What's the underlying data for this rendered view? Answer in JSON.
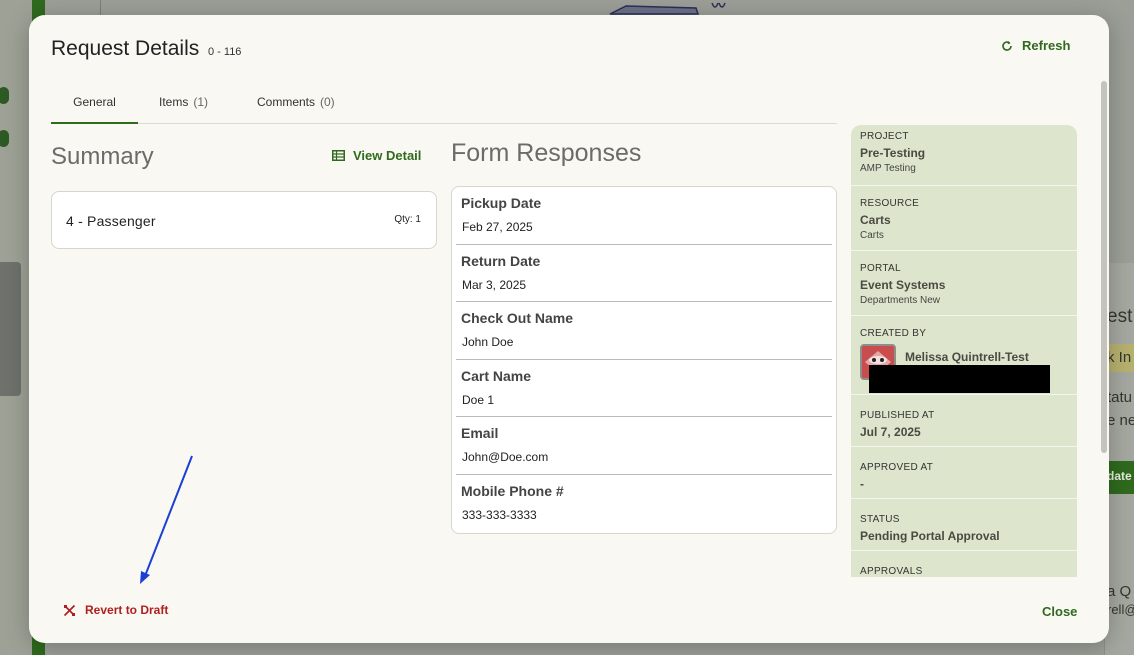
{
  "modal": {
    "title": "Request Details",
    "request_id": "0 - 116",
    "refresh_label": "Refresh",
    "revert_label": "Revert to Draft",
    "close_label": "Close"
  },
  "tabs": [
    {
      "label": "General",
      "count": ""
    },
    {
      "label": "Items",
      "count": "(1)"
    },
    {
      "label": "Comments",
      "count": "(0)"
    }
  ],
  "summary": {
    "title": "Summary",
    "view_detail_label": "View Detail",
    "items": [
      {
        "name": "4 - Passenger",
        "qty": "Qty: 1"
      }
    ]
  },
  "form_responses": {
    "title": "Form Responses",
    "fields": [
      {
        "label": "Pickup Date",
        "value": "Feb 27, 2025"
      },
      {
        "label": "Return Date",
        "value": "Mar 3, 2025"
      },
      {
        "label": "Check Out Name",
        "value": "John Doe"
      },
      {
        "label": "Cart Name",
        "value": "Doe 1"
      },
      {
        "label": "Email",
        "value": "John@Doe.com"
      },
      {
        "label": "Mobile Phone #",
        "value": "333-333-3333"
      }
    ]
  },
  "side_panel": {
    "project": {
      "label": "PROJECT",
      "value": "Pre-Testing",
      "sub": "AMP Testing"
    },
    "resource": {
      "label": "RESOURCE",
      "value": "Carts",
      "sub": "Carts"
    },
    "portal": {
      "label": "PORTAL",
      "value": "Event Systems",
      "sub": "Departments New"
    },
    "created_by": {
      "label": "CREATED BY",
      "value": "Melissa Quintrell-Test"
    },
    "published_at": {
      "label": "PUBLISHED AT",
      "value": "Jul 7, 2025"
    },
    "approved_at": {
      "label": "APPROVED AT",
      "value": "-"
    },
    "status": {
      "label": "STATUS",
      "value": "Pending Portal Approval"
    },
    "approvals": {
      "label": "APPROVALS"
    }
  },
  "background": {
    "right_texts": [
      "est",
      "k In",
      "tatu",
      "e ne",
      "date",
      "a Q",
      "rell@"
    ]
  },
  "colors": {
    "accent_green": "#2f6a1e",
    "danger_red": "#b01f1f",
    "side_panel_bg": "#dde6cd",
    "modal_bg": "#faf8f2",
    "annotation_arrow": "#1a3fd6"
  }
}
